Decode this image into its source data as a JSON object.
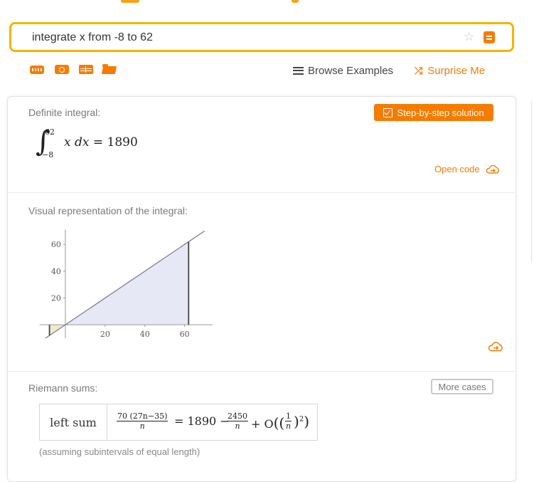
{
  "search": {
    "query": "integrate x from -8 to 62"
  },
  "toolbar": {
    "browse_label": "Browse Examples",
    "surprise_label": "Surprise Me"
  },
  "definite_integral": {
    "title": "Definite integral:",
    "lower": "−8",
    "upper": "62",
    "integrand": "x",
    "differential": "dx",
    "equals": "=",
    "result": "1890",
    "step_button": "Step-by-step solution",
    "open_code": "Open code"
  },
  "visual": {
    "title": "Visual representation of the integral:"
  },
  "riemann": {
    "title": "Riemann sums:",
    "more_cases": "More cases",
    "row_label": "left sum",
    "frac1_num": "70 (27n−35)",
    "frac1_den": "n",
    "eq": "= 1890 −",
    "frac2_num": "2450",
    "frac2_den": "n",
    "big_o": "+ O",
    "one": "1",
    "n": "n",
    "sq": "2",
    "note": "(assuming subintervals of equal length)"
  },
  "colors": {
    "accent": "#f57c00",
    "search_border": "#f4b400",
    "fill": "#e7e8f5"
  },
  "chart_data": {
    "type": "area",
    "function": "y = x",
    "x": [
      -8,
      62
    ],
    "y": [
      -8,
      62
    ],
    "shaded_from": -8,
    "shaded_to": 62,
    "x_ticks": [
      20,
      40,
      60
    ],
    "y_ticks": [
      20,
      40,
      60
    ],
    "xlim": [
      -15,
      78
    ],
    "ylim": [
      -10,
      75
    ]
  }
}
